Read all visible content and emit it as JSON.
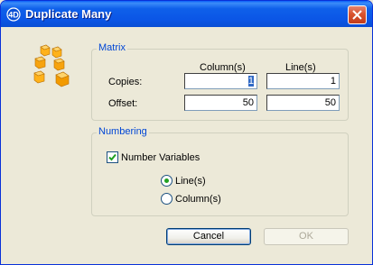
{
  "window": {
    "title": "Duplicate Many",
    "app_icon": "4D-logo-icon",
    "close_icon": "close-x-icon"
  },
  "decor": {
    "icon": "cubes-icon"
  },
  "matrix": {
    "title": "Matrix",
    "column_header": "Column(s)",
    "line_header": "Line(s)",
    "copies_label": "Copies:",
    "offset_label": "Offset:",
    "copies_column": "1",
    "copies_line": "1",
    "offset_column": "50",
    "offset_line": "50"
  },
  "numbering": {
    "title": "Numbering",
    "checkbox_label": "Number Variables",
    "checked": true,
    "options": [
      {
        "label": "Line(s)",
        "selected": true
      },
      {
        "label": "Column(s)",
        "selected": false
      }
    ]
  },
  "buttons": {
    "cancel": "Cancel",
    "ok": "OK"
  },
  "colors": {
    "title_bar": "#0a5ff7",
    "group_title": "#0046d5",
    "dialog_bg": "#ece9d8",
    "radio_selected": "#21a121"
  }
}
